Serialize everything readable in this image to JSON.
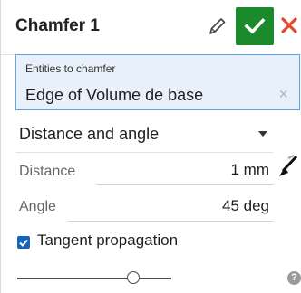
{
  "header": {
    "title": "Chamfer 1",
    "edit_icon": "pencil-icon",
    "ok_icon": "check-icon",
    "cancel_icon": "close-icon"
  },
  "entities": {
    "label": "Entities to chamfer",
    "value": "Edge of Volume de base",
    "clear_icon": "×"
  },
  "measurement": {
    "selected": "Distance and angle"
  },
  "fields": [
    {
      "label": "Distance",
      "value": "1 mm"
    },
    {
      "label": "Angle",
      "value": "45 deg"
    }
  ],
  "tangent": {
    "checked": true,
    "label": "Tangent propagation"
  },
  "slider": {
    "level": 0.75
  },
  "help": {
    "glyph": "?"
  },
  "colors": {
    "accent": "#1565c0",
    "ok": "#1a8a2c",
    "cancel": "#e34a2b",
    "selection_bg": "#e8f1fb",
    "selection_border": "#5aa2e2"
  }
}
